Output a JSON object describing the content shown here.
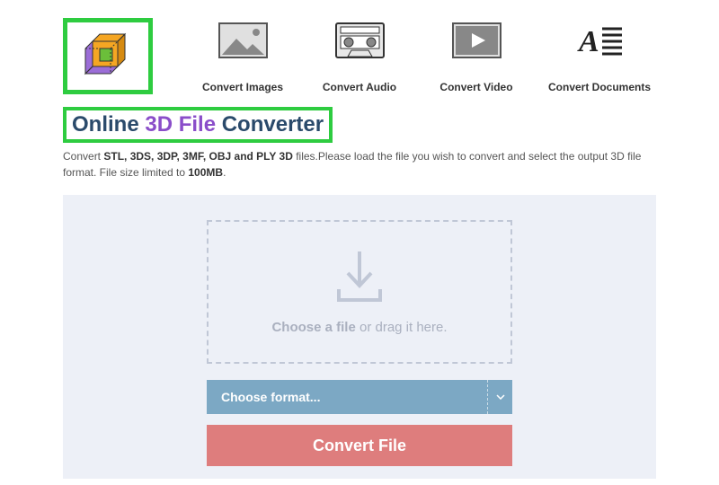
{
  "nav": {
    "images": "Convert Images",
    "audio": "Convert Audio",
    "video": "Convert Video",
    "docs": "Convert Documents"
  },
  "title": {
    "part1": "Online",
    "part2": "3D File",
    "part3": "Converter"
  },
  "subtitle": {
    "prefix": "Convert ",
    "formats": "STL, 3DS, 3DP, 3MF, OBJ and PLY 3D",
    "middle": " files.Please load the file you wish to convert and select the output 3D file format. File size limited to ",
    "limit": "100MB",
    "suffix": "."
  },
  "dropzone": {
    "bold": "Choose a file",
    "rest": " or drag it here."
  },
  "format_select": "Choose format...",
  "convert_button": "Convert File"
}
